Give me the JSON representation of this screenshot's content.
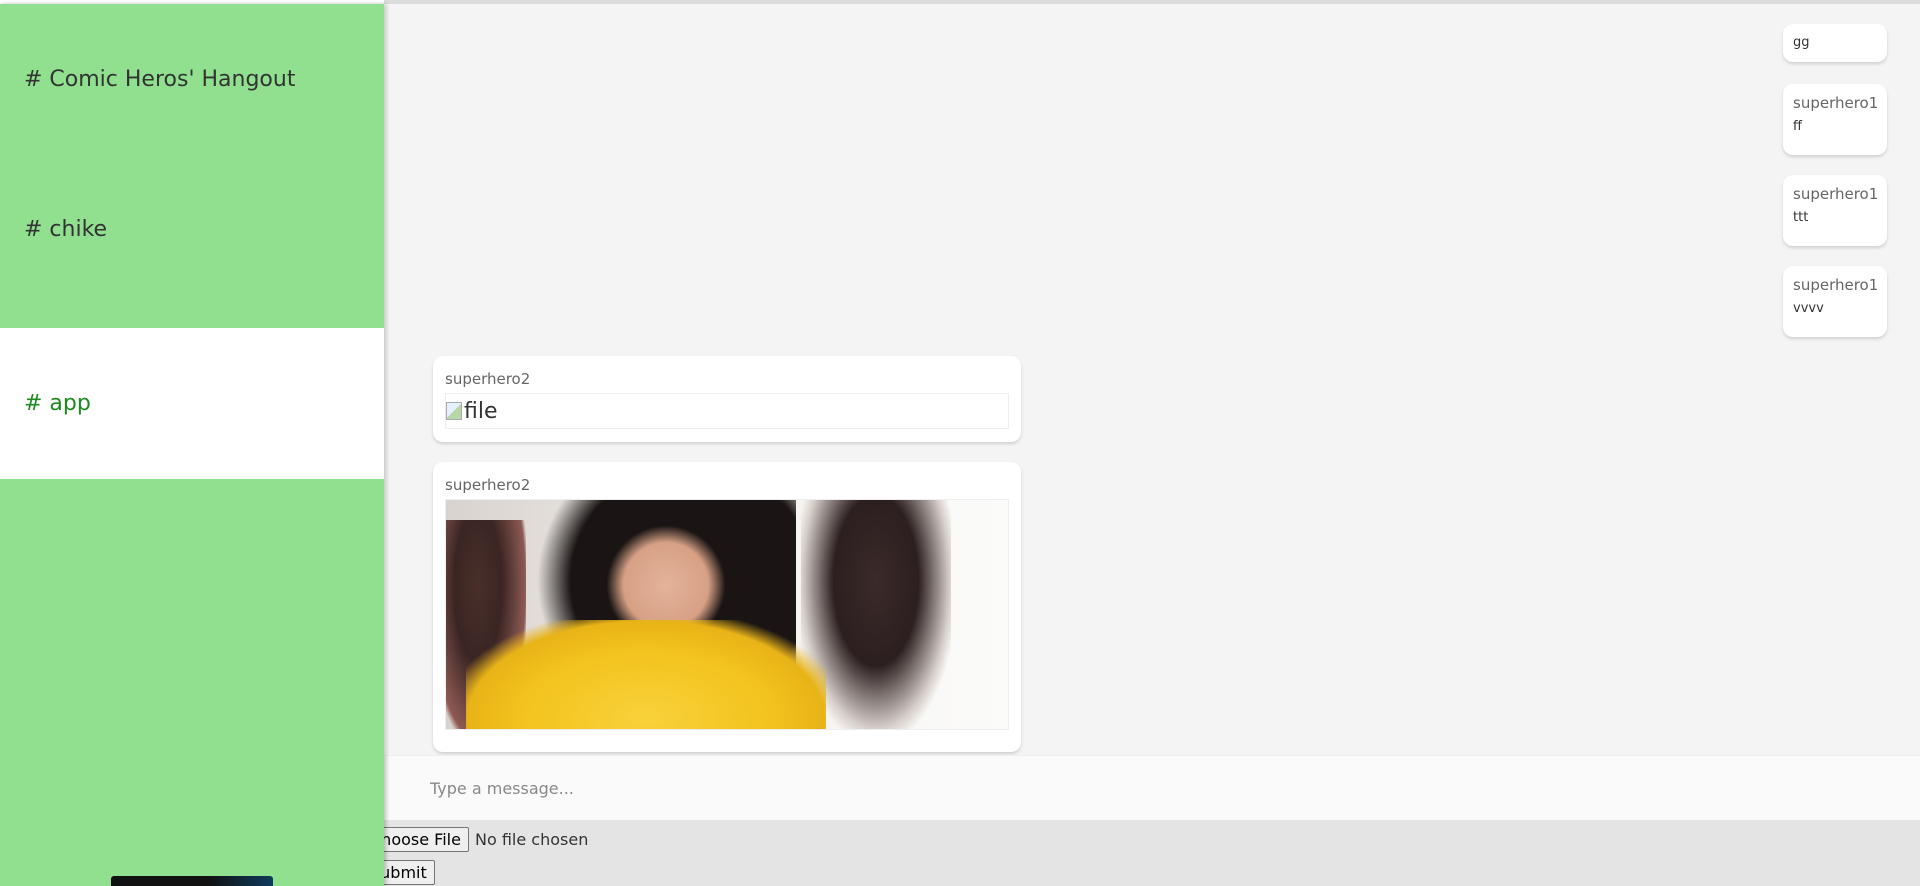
{
  "sidebar": {
    "rooms": [
      {
        "label": "# Comic Heros' Hangout",
        "active": false
      },
      {
        "label": "# chike",
        "active": false
      },
      {
        "label": "# app",
        "active": true
      }
    ]
  },
  "chat": {
    "right_messages": [
      {
        "author": "",
        "text": "gg"
      },
      {
        "author": "superhero1",
        "text": "ff"
      },
      {
        "author": "superhero1",
        "text": "ttt"
      },
      {
        "author": "superhero1",
        "text": "vvvv"
      }
    ],
    "left_messages": [
      {
        "author": "superhero2",
        "content_type": "broken-image",
        "alt": "file"
      },
      {
        "author": "superhero2",
        "content_type": "image"
      }
    ]
  },
  "composer": {
    "placeholder": "Type a message..."
  },
  "upload": {
    "choose_label": "Choose File",
    "status": "No file chosen",
    "submit_label": "Submit"
  },
  "colors": {
    "sidebar_bg": "#90e090",
    "active_room_text": "#1e8a1e",
    "chat_bg": "#f4f4f4"
  }
}
